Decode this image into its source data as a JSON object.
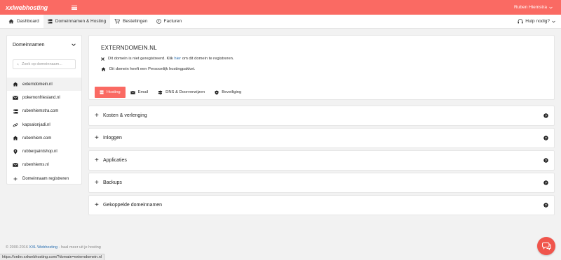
{
  "brand": "xxlwebhosting",
  "user": {
    "name": "Ruben Hiemstra"
  },
  "nav": {
    "items": [
      {
        "label": "Dashboard",
        "icon": "home-icon"
      },
      {
        "label": "Domeinnamen & Hosting",
        "icon": "storage-icon",
        "active": true
      },
      {
        "label": "Bestellingen",
        "icon": "cart-icon"
      },
      {
        "label": "Facturen",
        "icon": "euro-icon"
      }
    ],
    "help_label": "Hulp nodig?"
  },
  "sidebar": {
    "title": "Domeinnamen",
    "search_placeholder": "Zoek op domeinnaam...",
    "items": [
      {
        "label": "externdomein.nl",
        "icon": "home-icon",
        "active": true
      },
      {
        "label": "pokemonfriesland.nl",
        "icon": "mail-icon"
      },
      {
        "label": "rubenhiemstra.com",
        "icon": "storage-icon"
      },
      {
        "label": "kapsalonjadi.nl",
        "icon": "link-icon"
      },
      {
        "label": "rubenhiem.com",
        "icon": "home-icon"
      },
      {
        "label": "rubberpaintshop.nl",
        "icon": "map-pin-icon"
      },
      {
        "label": "rubenhiems.nl",
        "icon": "mail-icon"
      },
      {
        "label": "Domeinnaam registreren",
        "icon": "plus-icon"
      }
    ]
  },
  "domain": {
    "title": "EXTERNDOMEIN.NL",
    "line1_before": "Dit domein is niet geregistreerd. Klik",
    "line1_link": "hier",
    "line1_after": "om dit domein te registreren.",
    "line2": "Dit domein heeft een Persoonlijk hostingpakket.",
    "tabs": [
      {
        "label": "Hosting",
        "icon": "storage-icon",
        "active": true
      },
      {
        "label": "Email",
        "icon": "mail-icon"
      },
      {
        "label": "DNS & Doorverwijzen",
        "icon": "signpost-icon"
      },
      {
        "label": "Beveiliging",
        "icon": "shield-icon"
      }
    ]
  },
  "accordions": [
    {
      "label": "Kosten & verlenging"
    },
    {
      "label": "Inloggen"
    },
    {
      "label": "Applicaties"
    },
    {
      "label": "Backups"
    },
    {
      "label": "Gekoppelde domeinnamen"
    }
  ],
  "footer": {
    "copyright": "© 2000-2016",
    "brand_link": "XXL Webhosting",
    "tagline": "- haal meer uit je hosting"
  },
  "status_url": "https://order.xxlwebhosting.com/?domain=externdomein.nl",
  "colors": {
    "accent": "#fa6a63",
    "link": "#2a6fb0"
  }
}
